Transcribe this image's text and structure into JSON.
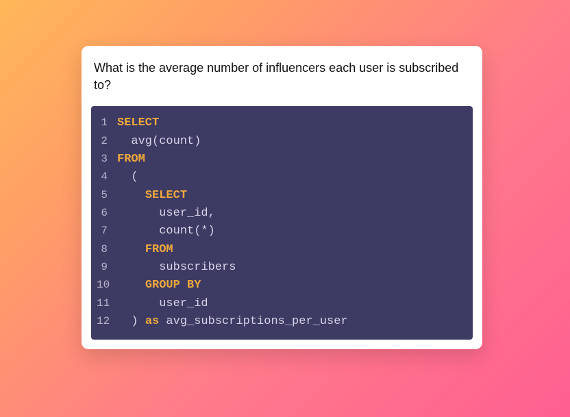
{
  "card": {
    "question": "What is the average number of influencers each user is subscribed to?"
  },
  "code": {
    "lines": [
      {
        "n": "1",
        "tokens": [
          {
            "t": "SELECT",
            "c": "kw"
          }
        ]
      },
      {
        "n": "2",
        "tokens": [
          {
            "t": "  avg(count)",
            "c": "plain"
          }
        ]
      },
      {
        "n": "3",
        "tokens": [
          {
            "t": "FROM",
            "c": "kw"
          }
        ]
      },
      {
        "n": "4",
        "tokens": [
          {
            "t": "  (",
            "c": "plain"
          }
        ]
      },
      {
        "n": "5",
        "tokens": [
          {
            "t": "    ",
            "c": "plain"
          },
          {
            "t": "SELECT",
            "c": "kw"
          }
        ]
      },
      {
        "n": "6",
        "tokens": [
          {
            "t": "      user_id,",
            "c": "plain"
          }
        ]
      },
      {
        "n": "7",
        "tokens": [
          {
            "t": "      count(*)",
            "c": "plain"
          }
        ]
      },
      {
        "n": "8",
        "tokens": [
          {
            "t": "    ",
            "c": "plain"
          },
          {
            "t": "FROM",
            "c": "kw"
          }
        ]
      },
      {
        "n": "9",
        "tokens": [
          {
            "t": "      subscribers",
            "c": "plain"
          }
        ]
      },
      {
        "n": "10",
        "tokens": [
          {
            "t": "    ",
            "c": "plain"
          },
          {
            "t": "GROUP BY",
            "c": "kw"
          }
        ]
      },
      {
        "n": "11",
        "tokens": [
          {
            "t": "      user_id",
            "c": "plain"
          }
        ]
      },
      {
        "n": "12",
        "tokens": [
          {
            "t": "  ) ",
            "c": "plain"
          },
          {
            "t": "as",
            "c": "kw"
          },
          {
            "t": " avg_subscriptions_per_user",
            "c": "plain"
          }
        ]
      }
    ]
  }
}
